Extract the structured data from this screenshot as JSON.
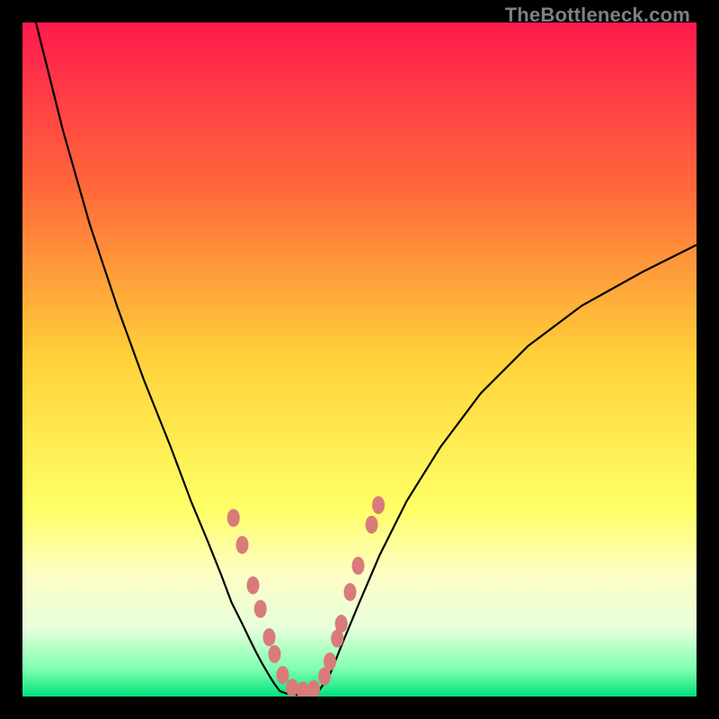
{
  "watermark": "TheBottleneck.com",
  "chart_data": {
    "type": "line",
    "title": "",
    "xlabel": "",
    "ylabel": "",
    "xlim": [
      0,
      100
    ],
    "ylim": [
      0,
      100
    ],
    "gradient_stops": [
      {
        "offset": 0,
        "color": "#ff1a4d"
      },
      {
        "offset": 0.25,
        "color": "#ff6a3a"
      },
      {
        "offset": 0.5,
        "color": "#ffd23a"
      },
      {
        "offset": 0.72,
        "color": "#ffff66"
      },
      {
        "offset": 0.82,
        "color": "#fdfdc5"
      },
      {
        "offset": 0.9,
        "color": "#e6ffdb"
      },
      {
        "offset": 0.96,
        "color": "#7dffb0"
      },
      {
        "offset": 1.0,
        "color": "#00e07a"
      }
    ],
    "series": [
      {
        "name": "left-curve",
        "x": [
          2,
          6,
          10,
          14,
          18,
          22,
          25,
          27.5,
          29.5,
          31,
          32.5,
          33.7,
          34.7,
          35.5,
          36.2,
          36.8,
          37.3,
          37.8,
          38.2
        ],
        "y": [
          100,
          84,
          70,
          58,
          47,
          37,
          29,
          23,
          18,
          14,
          11,
          8.5,
          6.5,
          5.0,
          3.8,
          2.8,
          2.0,
          1.3,
          0.8
        ]
      },
      {
        "name": "floor",
        "x": [
          38.2,
          39,
          40,
          41,
          42,
          43,
          44
        ],
        "y": [
          0.8,
          0.5,
          0.3,
          0.25,
          0.3,
          0.5,
          0.9
        ]
      },
      {
        "name": "right-curve",
        "x": [
          44,
          45.5,
          47.5,
          50,
          53,
          57,
          62,
          68,
          75,
          83,
          92,
          100
        ],
        "y": [
          0.9,
          3,
          8,
          14,
          21,
          29,
          37,
          45,
          52,
          58,
          63,
          67
        ]
      }
    ],
    "markers": {
      "color": "#d97b7b",
      "rx": 7,
      "ry": 10,
      "points": [
        {
          "x": 31.3,
          "y": 26.5
        },
        {
          "x": 32.6,
          "y": 22.5
        },
        {
          "x": 34.2,
          "y": 16.5
        },
        {
          "x": 35.3,
          "y": 13.0
        },
        {
          "x": 36.6,
          "y": 8.8
        },
        {
          "x": 37.4,
          "y": 6.3
        },
        {
          "x": 38.6,
          "y": 3.2
        },
        {
          "x": 40.0,
          "y": 1.3
        },
        {
          "x": 41.6,
          "y": 0.9
        },
        {
          "x": 43.2,
          "y": 1.1
        },
        {
          "x": 44.8,
          "y": 3.0
        },
        {
          "x": 45.6,
          "y": 5.2
        },
        {
          "x": 46.7,
          "y": 8.6
        },
        {
          "x": 47.3,
          "y": 10.8
        },
        {
          "x": 48.6,
          "y": 15.5
        },
        {
          "x": 49.8,
          "y": 19.4
        },
        {
          "x": 51.8,
          "y": 25.5
        },
        {
          "x": 52.8,
          "y": 28.4
        }
      ]
    }
  }
}
